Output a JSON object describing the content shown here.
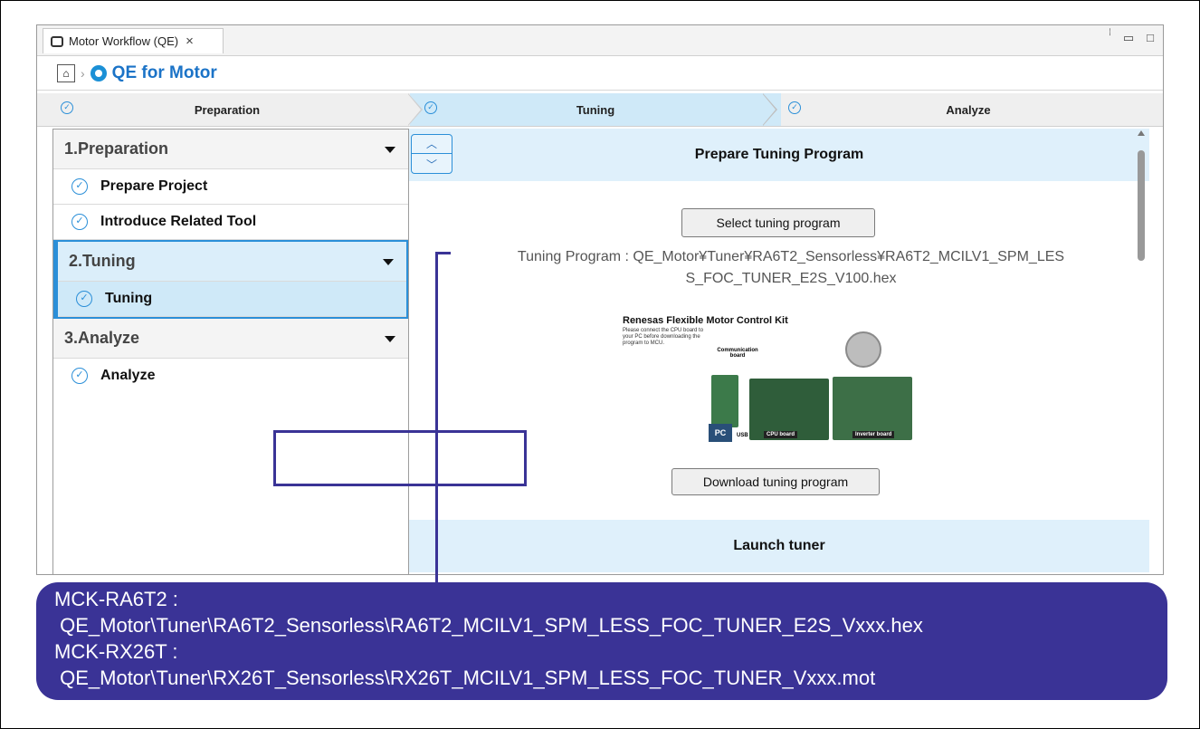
{
  "window": {
    "tab_title": "Motor Workflow (QE)",
    "breadcrumb_title": "QE for Motor"
  },
  "steps": [
    "Preparation",
    "Tuning",
    "Analyze"
  ],
  "sidebar": {
    "groups": [
      {
        "title": "1.Preparation",
        "items": [
          "Prepare Project",
          "Introduce Related Tool"
        ]
      },
      {
        "title": "2.Tuning",
        "items": [
          "Tuning"
        ]
      },
      {
        "title": "3.Analyze",
        "items": [
          "Analyze"
        ]
      }
    ]
  },
  "content": {
    "section1_title": "Prepare Tuning Program",
    "select_button": "Select tuning program",
    "tuning_program_line1": "Tuning Program : QE_Motor¥Tuner¥RA6T2_Sensorless¥RA6T2_MCILV1_SPM_LES",
    "tuning_program_line2": "S_FOC_TUNER_E2S_V100.hex",
    "kit_title": "Renesas Flexible Motor Control Kit",
    "kit_note": "Please connect the CPU board to your PC before downloading the program to MCU.",
    "kit_labels": {
      "comm": "Communication board",
      "pc": "PC",
      "usb": "USB",
      "cpu": "CPU board",
      "inverter": "Inverter board"
    },
    "download_button": "Download tuning program",
    "section2_title": "Launch tuner"
  },
  "callout": {
    "line1": "MCK-RA6T2 :",
    "line2": " QE_Motor\\Tuner\\RA6T2_Sensorless\\RA6T2_MCILV1_SPM_LESS_FOC_TUNER_E2S_Vxxx.hex",
    "line3": "MCK-RX26T :",
    "line4": " QE_Motor\\Tuner\\RX26T_Sensorless\\RX26T_MCILV1_SPM_LESS_FOC_TUNER_Vxxx.mot"
  },
  "colors": {
    "accent": "#2b8fd8",
    "callout_bg": "#3a3396",
    "section_bg": "#dff0fb"
  }
}
